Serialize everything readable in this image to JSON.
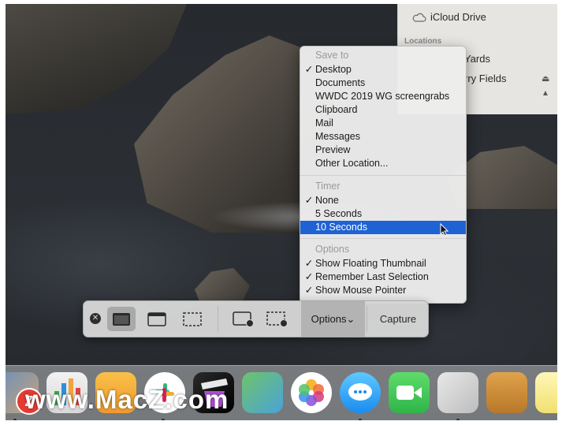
{
  "finder": {
    "icloud_label": "iCloud Drive",
    "section_label": "Locations",
    "location_1": "Yards",
    "location_2": "rry Fields",
    "eject_1": "⏏",
    "eject_2": "▲"
  },
  "menu": {
    "save_to_header": "Save to",
    "save_to_items": [
      {
        "label": "Desktop",
        "checked": true
      },
      {
        "label": "Documents",
        "checked": false
      },
      {
        "label": "WWDC 2019 WG screengrabs",
        "checked": false
      },
      {
        "label": "Clipboard",
        "checked": false
      },
      {
        "label": "Mail",
        "checked": false
      },
      {
        "label": "Messages",
        "checked": false
      },
      {
        "label": "Preview",
        "checked": false
      },
      {
        "label": "Other Location...",
        "checked": false
      }
    ],
    "timer_header": "Timer",
    "timer_items": [
      {
        "label": "None",
        "checked": true
      },
      {
        "label": "5 Seconds",
        "checked": false
      },
      {
        "label": "10 Seconds",
        "checked": false,
        "highlighted": true
      }
    ],
    "options_header": "Options",
    "options_items": [
      {
        "label": "Show Floating Thumbnail",
        "checked": true
      },
      {
        "label": "Remember Last Selection",
        "checked": true
      },
      {
        "label": "Show Mouse Pointer",
        "checked": true
      }
    ],
    "check_glyph": "✓",
    "highlight_color": "#1f62d4"
  },
  "toolbar": {
    "close_glyph": "✕",
    "options_label": "Options",
    "options_chevron": "⌄",
    "capture_label": "Capture"
  },
  "watermark": {
    "logo_letter": "Z",
    "text": "www.MacZ.com"
  }
}
